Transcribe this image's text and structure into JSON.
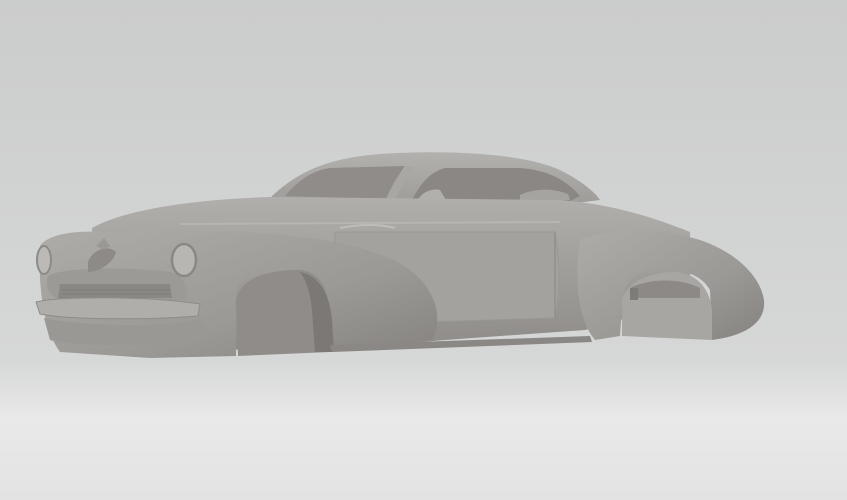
{
  "scene": {
    "subject": "car-body-shell",
    "colors": {
      "background_top": "#cbcccc",
      "background_mid": "#d6d7d7",
      "floor": "#e8e9e8",
      "body_light": "#a8a6a3",
      "body_mid": "#9a9895",
      "body_dark": "#7f7c79",
      "body_shadow": "#6d6a67",
      "glass_interior": "#8b8885"
    }
  }
}
